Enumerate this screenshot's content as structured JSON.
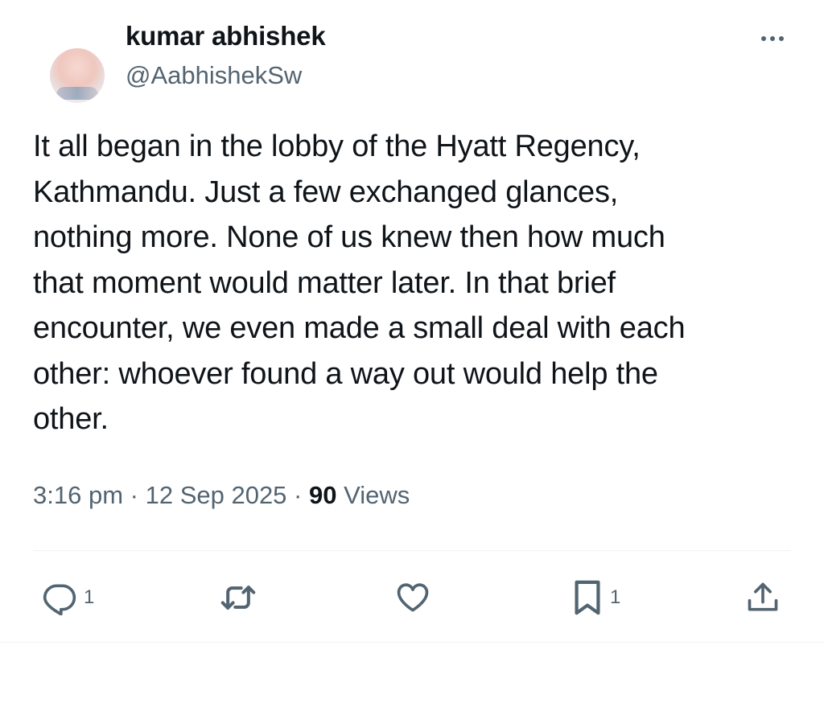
{
  "author": {
    "display_name": "kumar abhishek",
    "handle": "@AabhishekSw"
  },
  "tweet": {
    "text": "It all began in the lobby of the Hyatt Regency,\nKathmandu. Just a few exchanged glances,\nnothing more. None of us knew then how much\nthat moment would matter later. In that brief\nencounter, we even made a small deal with each\nother: whoever found a way out would help the\nother."
  },
  "meta": {
    "time": "3:16 pm",
    "separator": "·",
    "date": "12 Sep 2025",
    "views_count": "90",
    "views_label": "Views"
  },
  "actions": {
    "reply_count": "1",
    "bookmark_count": "1"
  },
  "icons": {
    "more": "more-horizontal-icon",
    "reply": "reply-icon",
    "retweet": "retweet-icon",
    "like": "heart-icon",
    "bookmark": "bookmark-icon",
    "share": "share-icon"
  },
  "colors": {
    "text_primary": "#0f1419",
    "text_secondary": "#536471",
    "divider": "#eff3f4"
  }
}
